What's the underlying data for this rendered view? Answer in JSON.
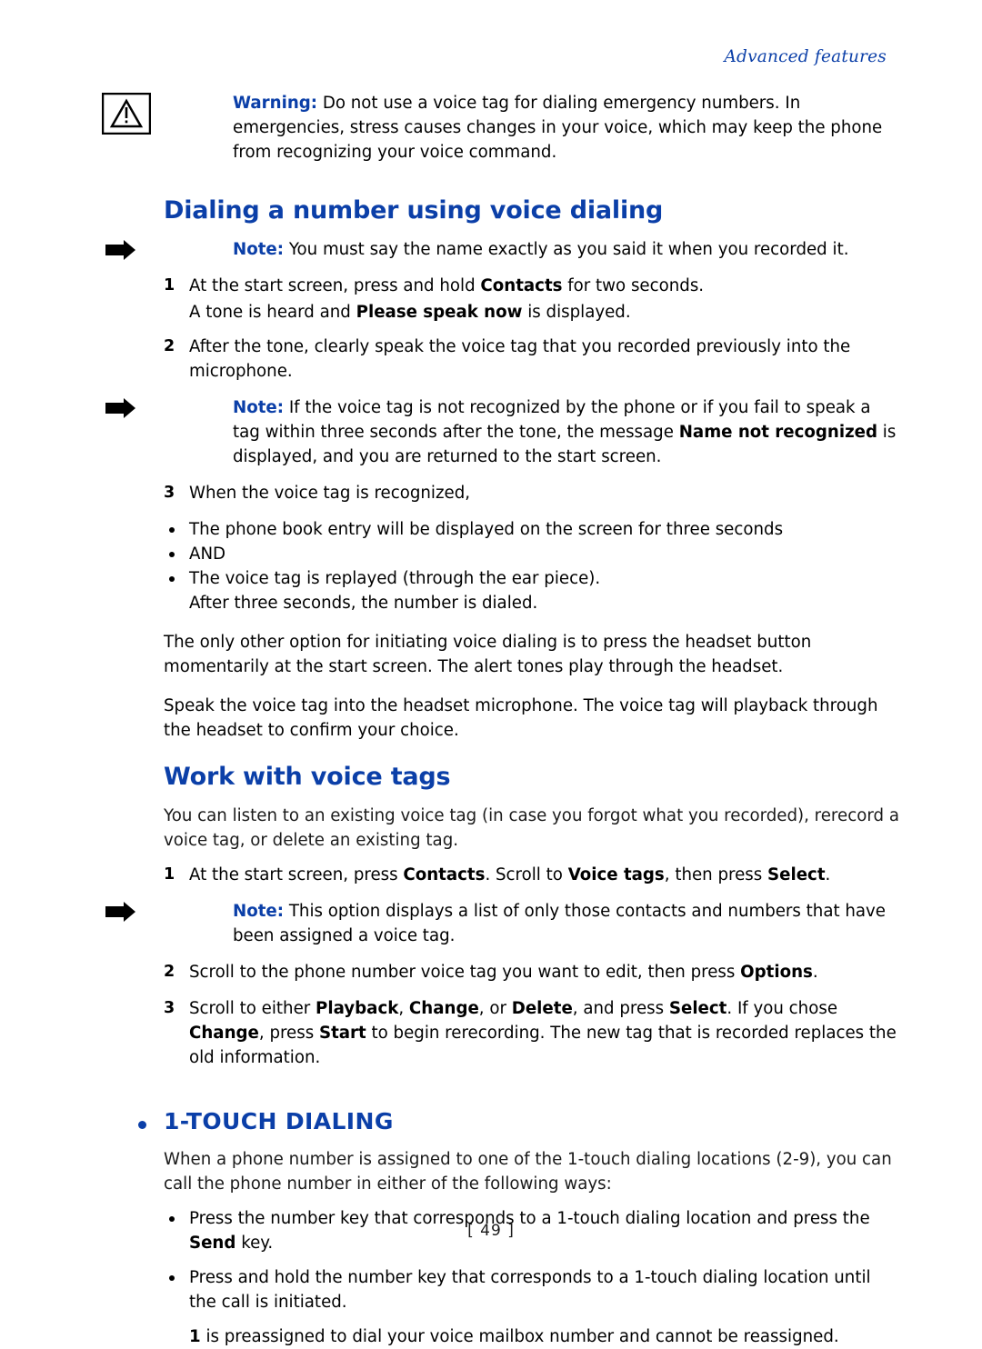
{
  "header": {
    "running_title": "Advanced features"
  },
  "warning": {
    "lead": "Warning:",
    "text": " Do not use a voice tag for dialing emergency numbers. In emergencies, stress causes changes in your voice, which may keep the phone from recognizing your voice command.",
    "icon": "warning-triangle-icon"
  },
  "sections": [
    {
      "id": "dialing-voice-dialing",
      "heading": "Dialing a number using voice dialing"
    },
    {
      "id": "work-with-voice-tags",
      "heading": "Work with voice tags"
    },
    {
      "id": "one-touch-dialing",
      "heading": "1-TOUCH DIALING"
    }
  ],
  "notes": {
    "note1": {
      "lead": "Note:",
      "text": " You must say the name exactly as you said it when you recorded it.",
      "icon": "note-pointer-icon"
    },
    "note2": {
      "lead": "Note:",
      "part1": " If the voice tag is not recognized by the phone or if you fail to speak a tag within three seconds after the tone, the message ",
      "bold1": "Name not recognized",
      "part2": " is displayed, and you are returned to the start screen.",
      "icon": "note-pointer-icon"
    },
    "note3": {
      "lead": "Note:",
      "text": " This option displays a list of only those contacts and numbers that have been assigned a voice tag.",
      "icon": "note-pointer-icon"
    }
  },
  "steps_dialing": [
    {
      "num": "1",
      "part1": "At the start screen, press and hold ",
      "bold1": "Contacts",
      "part2": " for two seconds."
    },
    {
      "num": "2",
      "part1": "After the tone, clearly speak the voice tag that you recorded previously into the microphone.",
      "bold1": "",
      "part2": ""
    },
    {
      "num": "3",
      "part1": "When the voice tag is recognized,",
      "bold1": "",
      "part2": ""
    }
  ],
  "substep_tone": {
    "part1": "A tone is heard and ",
    "bold1": "Please speak now",
    "part2": " is displayed."
  },
  "bullets_recognized": [
    "The phone book entry will be displayed on the screen for three seconds",
    "AND",
    "The voice tag is replayed (through the ear piece)."
  ],
  "after_three_seconds": "After three seconds, the number is dialed.",
  "paragraphs": {
    "headset_option": "The only other option for initiating voice dialing is to press the headset button momentarily at the start screen. The alert tones play through the headset.",
    "headset_speak": "Speak the voice tag into the headset microphone. The voice tag will playback through the headset to confirm your choice.",
    "voice_tags_intro": "You can listen to an existing voice tag (in case you forgot what you recorded), rerecord a voice tag, or delete an existing tag.",
    "one_touch_intro": "When a phone number is assigned to one of the 1-touch dialing locations (2-9), you can call the phone number in either of the following ways:",
    "one_preassigned_part1": "1",
    "one_preassigned_part2": " is preassigned to dial your voice mailbox number and cannot be reassigned."
  },
  "steps_voice_tags": [
    {
      "num": "1",
      "part1": "At the start screen, press ",
      "bold1": "Contacts",
      "part2": ". Scroll to ",
      "bold2": "Voice tags",
      "part3": ", then press ",
      "bold3": "Select",
      "part4": "."
    },
    {
      "num": "2",
      "part1": "Scroll to the phone number voice tag you want to edit, then press ",
      "bold1": "Options",
      "part2": ".",
      "bold2": "",
      "part3": "",
      "bold3": "",
      "part4": ""
    },
    {
      "num": "3",
      "part1": "Scroll to either ",
      "bold1": "Playback",
      "part2": ", ",
      "bold2": "Change",
      "part3": ", or ",
      "bold3": "Delete",
      "part4": ", and press "
    }
  ],
  "step3_tail": {
    "bold4": "Select",
    "part5": ". If you chose ",
    "bold5": "Change",
    "part6": ", press ",
    "bold6": "Start",
    "part7": " to begin rerecording. The new tag that is recorded replaces the old information."
  },
  "bullets_one_touch": [
    {
      "part1": "Press the number key that corresponds to a 1-touch dialing location and press the ",
      "bold1": "Send",
      "part2": " key."
    },
    {
      "part1": "Press and hold the number key that corresponds to a 1-touch dialing location until the call is initiated.",
      "bold1": "",
      "part2": ""
    }
  ],
  "footer": {
    "page_number": "[ 49 ]"
  },
  "colors": {
    "accent": "#0b3fa8",
    "text": "#1a1a1a"
  }
}
